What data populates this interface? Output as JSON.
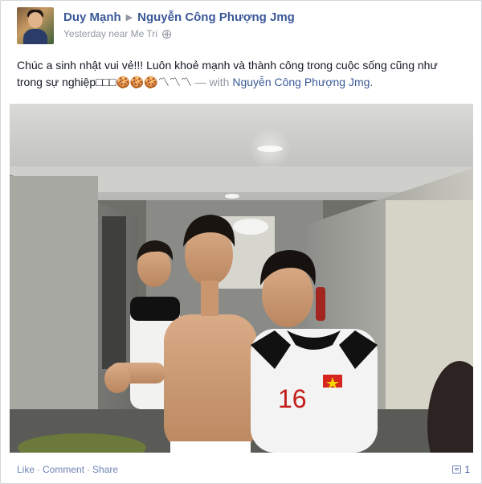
{
  "post": {
    "author": "Duy Mạnh",
    "tagged_to": "Nguyễn Công Phượng Jmg",
    "timestamp": "Yesterday near Me Tri",
    "message_line1": "Chúc a sinh nhật vui vẻ!!! Luôn khoẻ mạnh và thành công trong cuộc sống cũng như",
    "message_line2": "trong sự nghiệp□□□🍪🍪🍪〽〽〽",
    "message_with_prefix": " — with ",
    "message_with_name": "Nguyễn Công Phượng Jmg.",
    "jersey_number": "16"
  },
  "actions": {
    "like": "Like",
    "comment": "Comment",
    "share": "Share",
    "separator": "·"
  },
  "comments": {
    "count": "1",
    "icon": "comment-icon"
  },
  "icons": {
    "privacy": "globe-icon",
    "arrow": "arrow-right-icon"
  },
  "colors": {
    "link_blue": "#3b5998",
    "muted_gray": "#9197a3",
    "action_blue": "#6d84b4"
  }
}
